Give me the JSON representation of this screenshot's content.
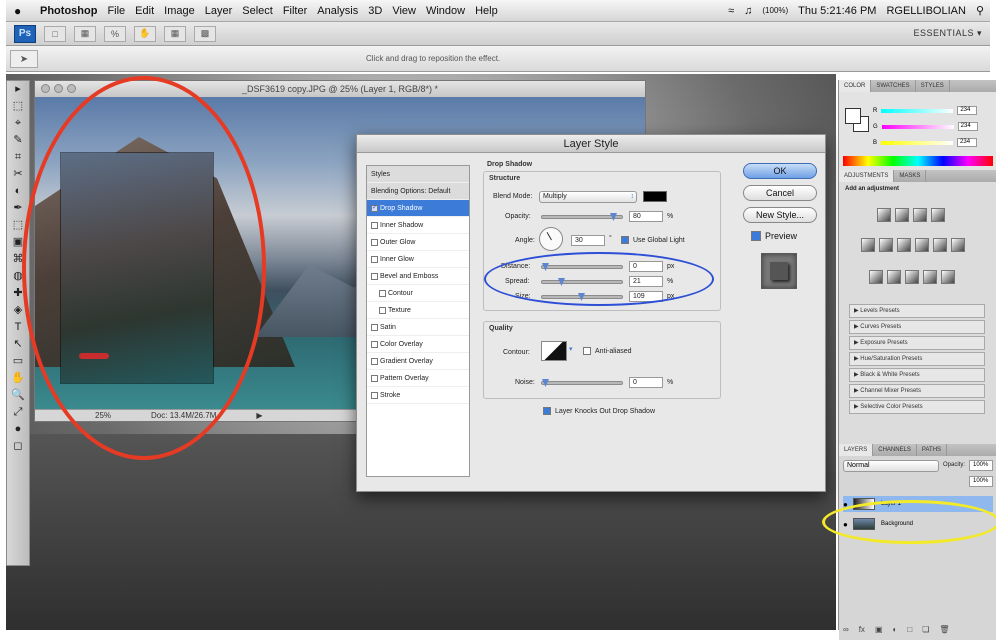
{
  "menubar": {
    "apple": "",
    "app": "Photoshop",
    "items": [
      "File",
      "Edit",
      "Image",
      "Layer",
      "Select",
      "Filter",
      "Analysis",
      "3D",
      "View",
      "Window",
      "Help"
    ],
    "battery": "(100%)",
    "clock": "Thu 5:21:46 PM",
    "user": "RGELLIBOLIAN"
  },
  "appbar": {
    "logo": "Ps",
    "workspace": "ESSENTIALS ▾"
  },
  "options": {
    "hint": "Click and drag to reposition the effect."
  },
  "tools": [
    "▸",
    "⬚",
    "⌖",
    "✎",
    "⌗",
    "✂",
    "◐",
    "✒",
    "⬚",
    "▣",
    "⌘",
    "◍",
    "✚",
    "◈",
    "T",
    "↖",
    "▭",
    "✋",
    "🔍",
    "⤢",
    "●",
    "◻"
  ],
  "document": {
    "title": "_DSF3619 copy.JPG @ 25% (Layer 1, RGB/8*) *",
    "zoom": "25%",
    "doc_size": "Doc: 13.4M/26.7M"
  },
  "dialog": {
    "title": "Layer Style",
    "styles_header": "Styles",
    "blending": "Blending Options: Default",
    "effects": [
      {
        "label": "Drop Shadow",
        "checked": true,
        "selected": true
      },
      {
        "label": "Inner Shadow",
        "checked": false
      },
      {
        "label": "Outer Glow",
        "checked": false
      },
      {
        "label": "Inner Glow",
        "checked": false
      },
      {
        "label": "Bevel and Emboss",
        "checked": false
      },
      {
        "label": "Contour",
        "checked": false,
        "indent": true
      },
      {
        "label": "Texture",
        "checked": false,
        "indent": true
      },
      {
        "label": "Satin",
        "checked": false
      },
      {
        "label": "Color Overlay",
        "checked": false
      },
      {
        "label": "Gradient Overlay",
        "checked": false
      },
      {
        "label": "Pattern Overlay",
        "checked": false
      },
      {
        "label": "Stroke",
        "checked": false
      }
    ],
    "section_title": "Drop Shadow",
    "structure": "Structure",
    "blend_mode_label": "Blend Mode:",
    "blend_mode": "Multiply",
    "opacity_label": "Opacity:",
    "opacity": "80",
    "angle_label": "Angle:",
    "angle": "30",
    "global_light": "Use Global Light",
    "distance_label": "Distance:",
    "distance": "0",
    "spread_label": "Spread:",
    "spread": "21",
    "size_label": "Size:",
    "size": "109",
    "unit_pct": "%",
    "unit_px": "px",
    "unit_deg": "°",
    "quality": "Quality",
    "contour_label": "Contour:",
    "anti_aliased": "Anti-aliased",
    "noise_label": "Noise:",
    "noise": "0",
    "knockout": "Layer Knocks Out Drop Shadow",
    "ok": "OK",
    "cancel": "Cancel",
    "new_style": "New Style...",
    "preview": "Preview"
  },
  "panels": {
    "color_tabs": [
      "COLOR",
      "SWATCHES",
      "STYLES"
    ],
    "rgb": [
      {
        "label": "R",
        "value": "234"
      },
      {
        "label": "G",
        "value": "234"
      },
      {
        "label": "B",
        "value": "234"
      }
    ],
    "adj_tabs": [
      "ADJUSTMENTS",
      "MASKS"
    ],
    "adj_title": "Add an adjustment",
    "presets": [
      "Levels Presets",
      "Curves Presets",
      "Exposure Presets",
      "Hue/Saturation Presets",
      "Black & White Presets",
      "Channel Mixer Presets",
      "Selective Color Presets"
    ],
    "layer_tabs": [
      "LAYERS",
      "CHANNELS",
      "PATHS"
    ],
    "blend": "Normal",
    "opacity_label": "Opacity:",
    "opacity": "100%",
    "fill": "100%",
    "layers": [
      {
        "name": "Layer 1",
        "selected": true
      },
      {
        "name": "Background",
        "selected": false
      }
    ]
  },
  "colors": {
    "accent": "#3d7bd8",
    "red_ring": "#e53b24",
    "blue_ring": "#2d4fd6",
    "yellow_ring": "#f3ea2a"
  }
}
